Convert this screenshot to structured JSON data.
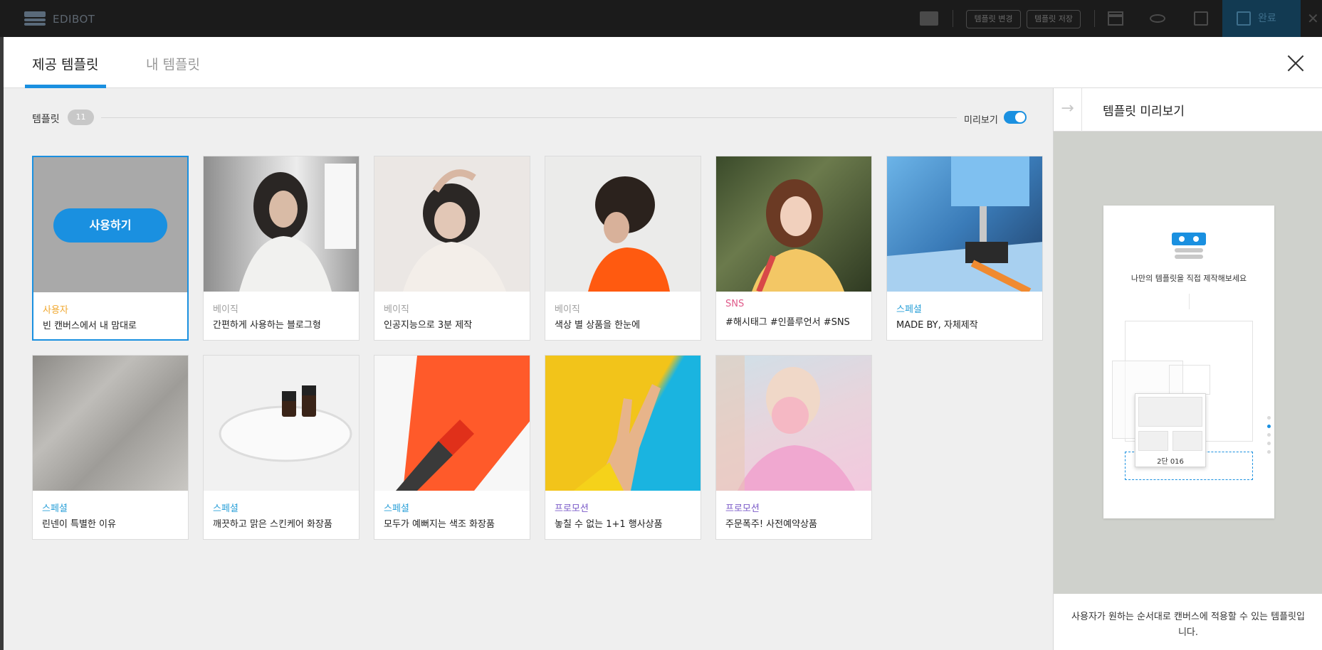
{
  "app": {
    "brand": "EDIBOT",
    "change_template_label": "템플릿 변경",
    "save_template_label": "템플릿 저장",
    "done_label": "완료"
  },
  "tabs": [
    {
      "label": "제공 템플릿",
      "active": true
    },
    {
      "label": "내 템플릿",
      "active": false
    }
  ],
  "toolbar": {
    "template_label": "템플릿",
    "template_count": "11",
    "preview_label": "미리보기",
    "preview_on": true
  },
  "cards": [
    {
      "category": "사용자",
      "category_color": "#f0a830",
      "title": "빈 캔버스에서 내 맘대로",
      "selected": true,
      "use_label": "사용하기"
    },
    {
      "category": "베이직",
      "category_color": "#a0a0a0",
      "title": "간편하게 사용하는 블로그형"
    },
    {
      "category": "베이직",
      "category_color": "#a0a0a0",
      "title": "인공지능으로 3분 제작"
    },
    {
      "category": "베이직",
      "category_color": "#a0a0a0",
      "title": "색상 별 상품을 한눈에"
    },
    {
      "category": "SNS",
      "category_color": "#e05a8a",
      "title": "#해시태그 #인플루언서 #SNS"
    },
    {
      "category": "스페셜",
      "category_color": "#2aa0d8",
      "title": "MADE BY, 자체제작"
    },
    {
      "category": "스페셜",
      "category_color": "#2aa0d8",
      "title": "린넨이 특별한 이유"
    },
    {
      "category": "스페셜",
      "category_color": "#2aa0d8",
      "title": "깨끗하고 맑은 스킨케어 화장품"
    },
    {
      "category": "스페셜",
      "category_color": "#2aa0d8",
      "title": "모두가 예뻐지는 색조 화장품"
    },
    {
      "category": "프로모션",
      "category_color": "#7a5ac8",
      "title": "놓칠 수 없는 1+1 행사상품"
    },
    {
      "category": "프로모션",
      "category_color": "#7a5ac8",
      "title": "주문폭주! 사전예약상품"
    }
  ],
  "side": {
    "title": "템플릿 미리보기",
    "preview_message": "나만의 템플릿을 직접 제작해보세요",
    "layout_label": "2단 016",
    "description": "사용자가 원하는 순서대로 캔버스에 적용할 수 있는 템플릿입니다."
  }
}
